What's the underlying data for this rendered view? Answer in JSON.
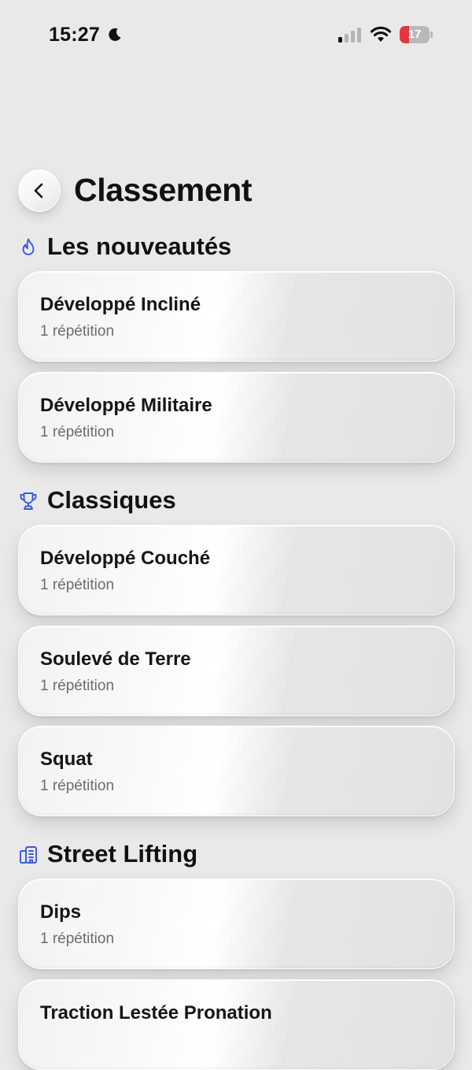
{
  "status_bar": {
    "time": "15:27",
    "battery_level": "17",
    "battery_fraction": 0.17,
    "icons": [
      "moon-icon",
      "signal-icon",
      "wifi-icon",
      "battery-icon"
    ],
    "battery_color": "#e4363c"
  },
  "header": {
    "back_icon": "chevron-left-icon",
    "title": "Classement"
  },
  "accent_color": "#3a5bd9",
  "sections": [
    {
      "icon": "flame-icon",
      "title": "Les nouveautés",
      "items": [
        {
          "name": "Développé Incliné",
          "subtitle": "1 répétition"
        },
        {
          "name": "Développé Militaire",
          "subtitle": "1 répétition"
        }
      ]
    },
    {
      "icon": "trophy-icon",
      "title": "Classiques",
      "items": [
        {
          "name": "Développé Couché",
          "subtitle": "1 répétition"
        },
        {
          "name": "Soulevé de Terre",
          "subtitle": "1 répétition"
        },
        {
          "name": "Squat",
          "subtitle": "1 répétition"
        }
      ]
    },
    {
      "icon": "building-icon",
      "title": "Street Lifting",
      "items": [
        {
          "name": "Dips",
          "subtitle": "1 répétition"
        },
        {
          "name": "Traction Lestée Pronation",
          "subtitle": ""
        }
      ]
    }
  ]
}
